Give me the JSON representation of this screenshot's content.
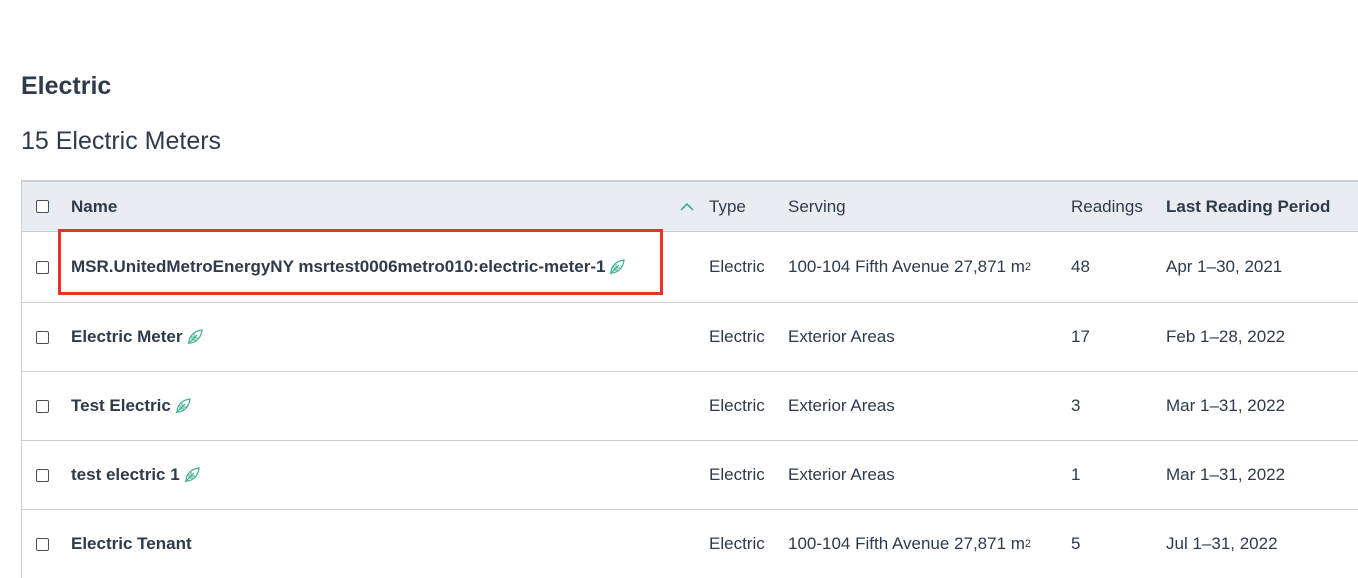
{
  "section": {
    "title": "Electric",
    "meters_count": "15 Electric Meters"
  },
  "table": {
    "headers": {
      "name": "Name",
      "type": "Type",
      "serving": "Serving",
      "readings": "Readings",
      "last_reading_period": "Last Reading Period"
    },
    "sort": {
      "column": "name",
      "direction": "ascending",
      "icon": "chevron-up-icon"
    },
    "rows": [
      {
        "name": "MSR.UnitedMetroEnergyNY msrtest0006metro010:electric-meter-1",
        "green": true,
        "type": "Electric",
        "serving": "100-104 Fifth Avenue 27,871 m",
        "serving_sup": "2",
        "readings": "48",
        "period": "Apr 1–30, 2021",
        "highlighted": true
      },
      {
        "name": "Electric Meter",
        "green": true,
        "type": "Electric",
        "serving": "Exterior Areas",
        "serving_sup": "",
        "readings": "17",
        "period": "Feb 1–28, 2022"
      },
      {
        "name": "Test Electric",
        "green": true,
        "type": "Electric",
        "serving": "Exterior Areas",
        "serving_sup": "",
        "readings": "3",
        "period": "Mar 1–31, 2022"
      },
      {
        "name": "test electric 1",
        "green": true,
        "type": "Electric",
        "serving": "Exterior Areas",
        "serving_sup": "",
        "readings": "1",
        "period": "Mar 1–31, 2022"
      },
      {
        "name": "Electric Tenant",
        "green": false,
        "type": "Electric",
        "serving": "100-104 Fifth Avenue 27,871 m",
        "serving_sup": "2",
        "readings": "5",
        "period": "Jul 1–31, 2022"
      }
    ]
  },
  "colors": {
    "accent_green": "#3bb08f",
    "highlight_red": "#e8322a",
    "header_bg": "#e9edf2",
    "text": "#2f3a4a"
  }
}
